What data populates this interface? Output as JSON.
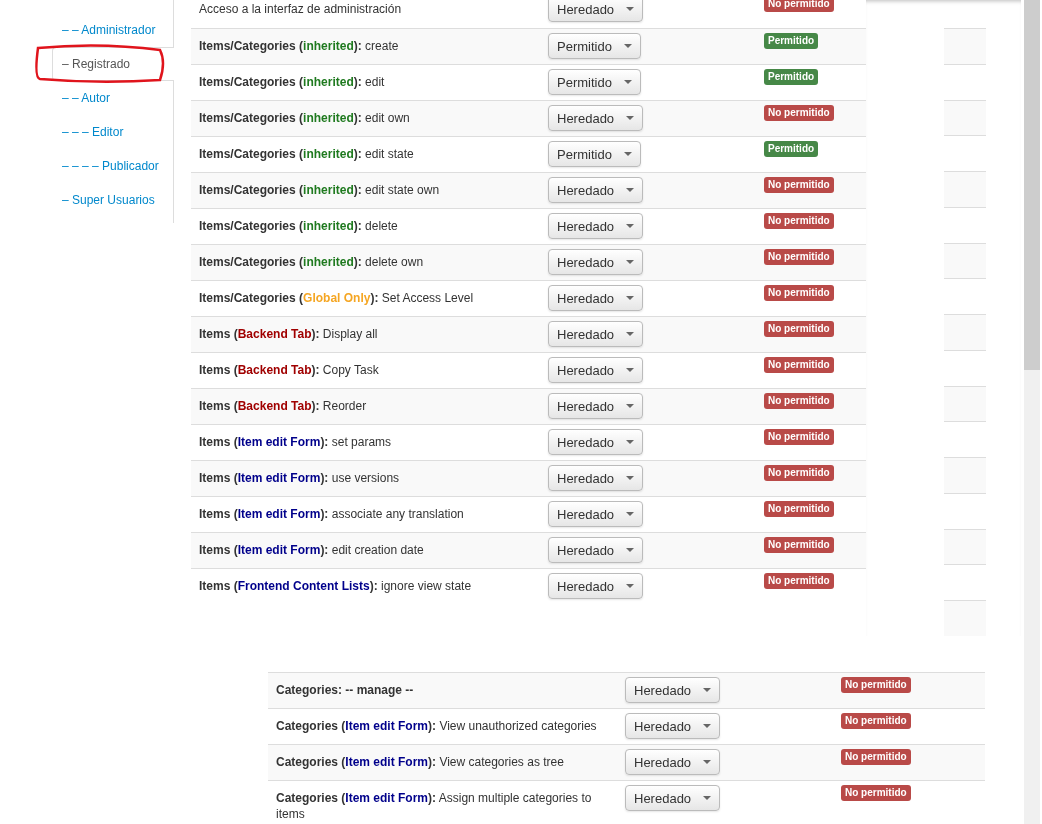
{
  "sidebar": {
    "items": [
      {
        "label": "– – Administrador",
        "selected": false
      },
      {
        "label": "– Registrado",
        "selected": true
      },
      {
        "label": "– – Autor",
        "selected": false
      },
      {
        "label": "– – – Editor",
        "selected": false
      },
      {
        "label": "– – – – Publicador",
        "selected": false
      },
      {
        "label": "– Super Usuarios",
        "selected": false
      }
    ]
  },
  "tables": [
    {
      "rows": [
        {
          "label": [
            {
              "kind": "plain",
              "text": "Acceso a la interfaz de administración"
            }
          ],
          "setting": "Heredado",
          "result": {
            "text": "No permitido",
            "allowed": false
          }
        },
        {
          "label": [
            {
              "kind": "bold",
              "text": "Items/Categories ("
            },
            {
              "kind": "scope",
              "text": "inherited",
              "color": "#1f7a1f"
            },
            {
              "kind": "bold",
              "text": "):"
            },
            {
              "kind": "plain",
              "text": " create"
            }
          ],
          "setting": "Permitido",
          "result": {
            "text": "Permitido",
            "allowed": true
          }
        },
        {
          "label": [
            {
              "kind": "bold",
              "text": "Items/Categories ("
            },
            {
              "kind": "scope",
              "text": "inherited",
              "color": "#1f7a1f"
            },
            {
              "kind": "bold",
              "text": "):"
            },
            {
              "kind": "plain",
              "text": " edit"
            }
          ],
          "setting": "Permitido",
          "result": {
            "text": "Permitido",
            "allowed": true
          }
        },
        {
          "label": [
            {
              "kind": "bold",
              "text": "Items/Categories ("
            },
            {
              "kind": "scope",
              "text": "inherited",
              "color": "#1f7a1f"
            },
            {
              "kind": "bold",
              "text": "):"
            },
            {
              "kind": "plain",
              "text": " edit own"
            }
          ],
          "setting": "Heredado",
          "result": {
            "text": "No permitido",
            "allowed": false
          }
        },
        {
          "label": [
            {
              "kind": "bold",
              "text": "Items/Categories ("
            },
            {
              "kind": "scope",
              "text": "inherited",
              "color": "#1f7a1f"
            },
            {
              "kind": "bold",
              "text": "):"
            },
            {
              "kind": "plain",
              "text": " edit state"
            }
          ],
          "setting": "Permitido",
          "result": {
            "text": "Permitido",
            "allowed": true
          }
        },
        {
          "label": [
            {
              "kind": "bold",
              "text": "Items/Categories ("
            },
            {
              "kind": "scope",
              "text": "inherited",
              "color": "#1f7a1f"
            },
            {
              "kind": "bold",
              "text": "):"
            },
            {
              "kind": "plain",
              "text": " edit state own"
            }
          ],
          "setting": "Heredado",
          "result": {
            "text": "No permitido",
            "allowed": false
          }
        },
        {
          "label": [
            {
              "kind": "bold",
              "text": "Items/Categories ("
            },
            {
              "kind": "scope",
              "text": "inherited",
              "color": "#1f7a1f"
            },
            {
              "kind": "bold",
              "text": "):"
            },
            {
              "kind": "plain",
              "text": " delete"
            }
          ],
          "setting": "Heredado",
          "result": {
            "text": "No permitido",
            "allowed": false
          }
        },
        {
          "label": [
            {
              "kind": "bold",
              "text": "Items/Categories ("
            },
            {
              "kind": "scope",
              "text": "inherited",
              "color": "#1f7a1f"
            },
            {
              "kind": "bold",
              "text": "):"
            },
            {
              "kind": "plain",
              "text": " delete own"
            }
          ],
          "setting": "Heredado",
          "result": {
            "text": "No permitido",
            "allowed": false
          }
        },
        {
          "label": [
            {
              "kind": "bold",
              "text": "Items/Categories ("
            },
            {
              "kind": "scope",
              "text": "Global Only",
              "color": "#f5a623"
            },
            {
              "kind": "bold",
              "text": "):"
            },
            {
              "kind": "plain",
              "text": " Set Access Level"
            }
          ],
          "setting": "Heredado",
          "result": {
            "text": "No permitido",
            "allowed": false
          }
        },
        {
          "label": [
            {
              "kind": "bold",
              "text": "Items ("
            },
            {
              "kind": "scope",
              "text": "Backend Tab",
              "color": "#a00000"
            },
            {
              "kind": "bold",
              "text": "):"
            },
            {
              "kind": "plain",
              "text": " Display all"
            }
          ],
          "setting": "Heredado",
          "result": {
            "text": "No permitido",
            "allowed": false
          }
        },
        {
          "label": [
            {
              "kind": "bold",
              "text": "Items ("
            },
            {
              "kind": "scope",
              "text": "Backend Tab",
              "color": "#a00000"
            },
            {
              "kind": "bold",
              "text": "):"
            },
            {
              "kind": "plain",
              "text": " Copy Task"
            }
          ],
          "setting": "Heredado",
          "result": {
            "text": "No permitido",
            "allowed": false
          }
        },
        {
          "label": [
            {
              "kind": "bold",
              "text": "Items ("
            },
            {
              "kind": "scope",
              "text": "Backend Tab",
              "color": "#a00000"
            },
            {
              "kind": "bold",
              "text": "):"
            },
            {
              "kind": "plain",
              "text": " Reorder"
            }
          ],
          "setting": "Heredado",
          "result": {
            "text": "No permitido",
            "allowed": false
          }
        },
        {
          "label": [
            {
              "kind": "bold",
              "text": "Items ("
            },
            {
              "kind": "scope",
              "text": "Item edit Form",
              "color": "#00008b"
            },
            {
              "kind": "bold",
              "text": "):"
            },
            {
              "kind": "plain",
              "text": " set params"
            }
          ],
          "setting": "Heredado",
          "result": {
            "text": "No permitido",
            "allowed": false
          }
        },
        {
          "label": [
            {
              "kind": "bold",
              "text": "Items ("
            },
            {
              "kind": "scope",
              "text": "Item edit Form",
              "color": "#00008b"
            },
            {
              "kind": "bold",
              "text": "):"
            },
            {
              "kind": "plain",
              "text": " use versions"
            }
          ],
          "setting": "Heredado",
          "result": {
            "text": "No permitido",
            "allowed": false
          }
        },
        {
          "label": [
            {
              "kind": "bold",
              "text": "Items ("
            },
            {
              "kind": "scope",
              "text": "Item edit Form",
              "color": "#00008b"
            },
            {
              "kind": "bold",
              "text": "):"
            },
            {
              "kind": "plain",
              "text": " associate any translation"
            }
          ],
          "setting": "Heredado",
          "result": {
            "text": "No permitido",
            "allowed": false
          }
        },
        {
          "label": [
            {
              "kind": "bold",
              "text": "Items ("
            },
            {
              "kind": "scope",
              "text": "Item edit Form",
              "color": "#00008b"
            },
            {
              "kind": "bold",
              "text": "):"
            },
            {
              "kind": "plain",
              "text": " edit creation date"
            }
          ],
          "setting": "Heredado",
          "result": {
            "text": "No permitido",
            "allowed": false
          }
        },
        {
          "label": [
            {
              "kind": "bold",
              "text": "Items ("
            },
            {
              "kind": "scope",
              "text": "Frontend Content Lists",
              "color": "#00008b"
            },
            {
              "kind": "bold",
              "text": "):"
            },
            {
              "kind": "plain",
              "text": " ignore view state"
            }
          ],
          "setting": "Heredado",
          "result": {
            "text": "No permitido",
            "allowed": false
          }
        }
      ]
    },
    {
      "rows": [
        {
          "label": [
            {
              "kind": "bold",
              "text": "Categories: -- manage --"
            }
          ],
          "setting": "Heredado",
          "result": {
            "text": "No permitido",
            "allowed": false
          }
        },
        {
          "label": [
            {
              "kind": "bold",
              "text": "Categories ("
            },
            {
              "kind": "scope",
              "text": "Item edit Form",
              "color": "#00008b"
            },
            {
              "kind": "bold",
              "text": "):"
            },
            {
              "kind": "plain",
              "text": " View unauthorized categories"
            }
          ],
          "setting": "Heredado",
          "result": {
            "text": "No permitido",
            "allowed": false
          }
        },
        {
          "label": [
            {
              "kind": "bold",
              "text": "Categories ("
            },
            {
              "kind": "scope",
              "text": "Item edit Form",
              "color": "#00008b"
            },
            {
              "kind": "bold",
              "text": "):"
            },
            {
              "kind": "plain",
              "text": " View categories as tree"
            }
          ],
          "setting": "Heredado",
          "result": {
            "text": "No permitido",
            "allowed": false
          }
        },
        {
          "label": [
            {
              "kind": "bold",
              "text": "Categories ("
            },
            {
              "kind": "scope",
              "text": "Item edit Form",
              "color": "#00008b"
            },
            {
              "kind": "bold",
              "text": "):"
            },
            {
              "kind": "plain",
              "text": " Assign multiple categories to items"
            }
          ],
          "setting": "Heredado",
          "result": {
            "text": "No permitido",
            "allowed": false
          }
        }
      ]
    }
  ]
}
